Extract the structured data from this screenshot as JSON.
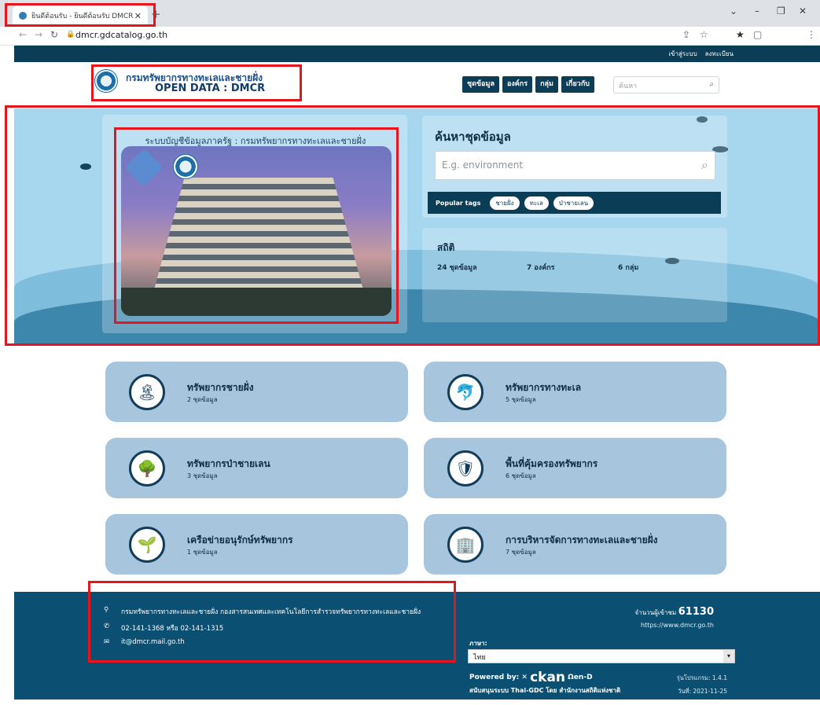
{
  "browser": {
    "tab_title": "ยินดีต้อนรับ - ยินดีต้อนรับ DMCR",
    "tab_close": "✕",
    "new_tab": "+",
    "url": "dmcr.gdcatalog.go.th",
    "controls": {
      "minimize": "–",
      "maximize": "❐",
      "close": "✕",
      "menu": "⌄"
    }
  },
  "topbar": {
    "login": "เข้าสู่ระบบ",
    "register": "ลงทะเบียน"
  },
  "header": {
    "site_th": "กรมทรัพยากรทางทะเลและชายฝั่ง",
    "site_en": "OPEN DATA : DMCR",
    "nav": [
      "ชุดข้อมูล",
      "องค์กร",
      "กลุ่ม",
      "เกี่ยวกับ"
    ],
    "search_placeholder": "ค้นหา"
  },
  "hero": {
    "caption": "ระบบบัญชีข้อมูลภาครัฐ : กรมทรัพยากรทางทะเลและชายฝั่ง",
    "search_title": "ค้นหาชุดข้อมูล",
    "search_placeholder": "E.g. environment",
    "popular_label": "Popular tags",
    "tags": [
      "ชายฝั่ง",
      "ทะเล",
      "ป่าชายเลน"
    ],
    "stats_title": "สถิติ",
    "stats": [
      "24 ชุดข้อมูล",
      "7 องค์กร",
      "6 กลุ่ม"
    ]
  },
  "groups": [
    {
      "title": "ทรัพยากรชายฝั่ง",
      "count": "2 ชุดข้อมูล",
      "icon": "island-icon"
    },
    {
      "title": "ทรัพยากรทางทะเล",
      "count": "5 ชุดข้อมูล",
      "icon": "dolphin-icon"
    },
    {
      "title": "ทรัพยากรป่าชายเลน",
      "count": "3 ชุดข้อมูล",
      "icon": "mangrove-icon"
    },
    {
      "title": "พื้นที่คุ้มครองทรัพยากร",
      "count": "6 ชุดข้อมูล",
      "icon": "shield-leaf-icon"
    },
    {
      "title": "เครือข่ายอนุรักษ์ทรัพยากร",
      "count": "1 ชุดข้อมูล",
      "icon": "hand-plant-icon"
    },
    {
      "title": "การบริหารจัดการทางทะเลและชายฝั่ง",
      "count": "7 ชุดข้อมูล",
      "icon": "building-chart-icon"
    }
  ],
  "footer": {
    "address": "กรมทรัพยากรทางทะเลและชายฝั่ง กองสารสนเทศและเทคโนโลยีการสำรวจทรัพยากรทางทะเลและชายฝั่ง",
    "phone": "02-141-1368 หรือ 02-141-1315",
    "email": "it@dmcr.mail.go.th",
    "visits_label": "จำนวนผู้เข้าชม",
    "visits_value": "61130",
    "website": "https://www.dmcr.go.th",
    "lang_label": "ภาษา:",
    "lang_value": "ไทย",
    "powered_by": "Powered by:",
    "ckan": "ckan",
    "opend": "Ωen-D",
    "support": "สนับสนุนระบบ Thai-GDC โดย สำนักงานสถิติแห่งชาติ",
    "version": "รุ่นโปรแกรม: 1.4.1",
    "date": "วันที่: 2021-11-25"
  },
  "colors": {
    "navy": "#0b3d57",
    "hero_bg": "#a7d7ee",
    "card": "#a7c5dd",
    "footer": "#0b5072",
    "annotation": "#e8141c"
  }
}
